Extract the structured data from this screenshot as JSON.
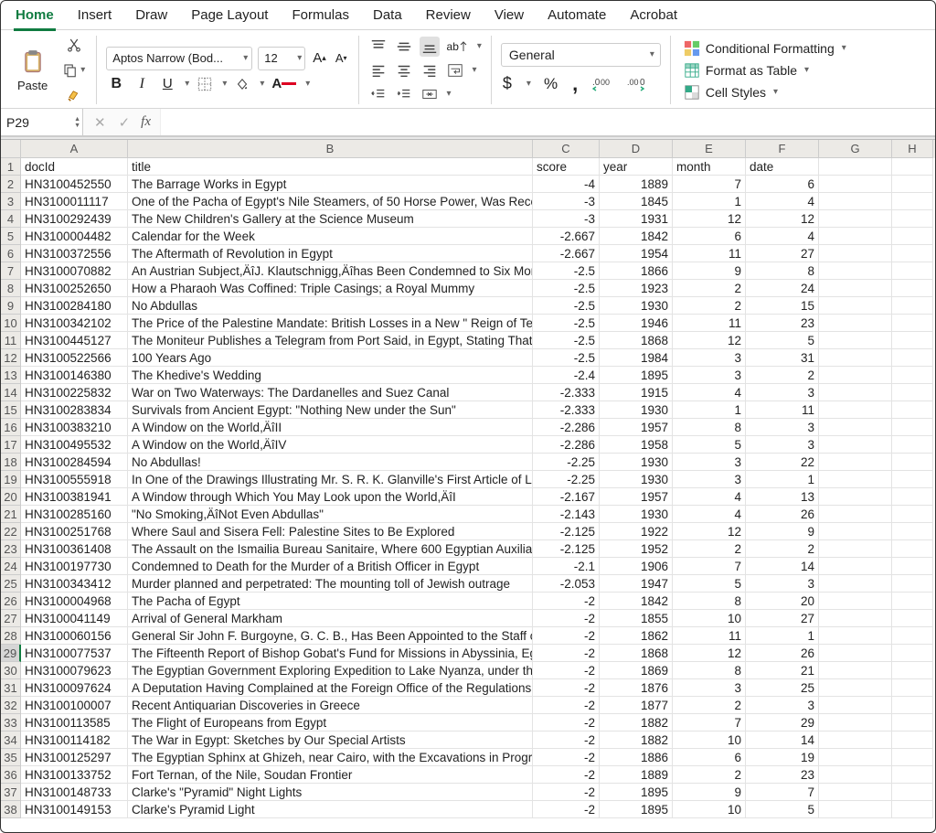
{
  "tabs": [
    "Home",
    "Insert",
    "Draw",
    "Page Layout",
    "Formulas",
    "Data",
    "Review",
    "View",
    "Automate",
    "Acrobat"
  ],
  "activeTab": 0,
  "ribbon": {
    "paste_label": "Paste",
    "font_name": "Aptos Narrow (Bod...",
    "font_size": "12",
    "number_format": "General",
    "styles": {
      "cond_fmt": "Conditional Formatting",
      "fmt_table": "Format as Table",
      "cell_styles": "Cell Styles"
    }
  },
  "namebox": "P29",
  "columns": [
    "A",
    "B",
    "C",
    "D",
    "E",
    "F",
    "G",
    "H"
  ],
  "headerRow": [
    "docId",
    "title",
    "score",
    "year",
    "month",
    "date"
  ],
  "rows": [
    {
      "n": 1
    },
    {
      "n": 2,
      "A": "HN3100452550",
      "B": "The Barrage Works in Egypt",
      "C": "-4",
      "D": "1889",
      "E": "7",
      "F": "6"
    },
    {
      "n": 3,
      "A": "HN3100011117",
      "B": "One of the Pacha of Egypt's Nile Steamers, of 50 Horse Power, Was Recently L",
      "C": "-3",
      "D": "1845",
      "E": "1",
      "F": "4"
    },
    {
      "n": 4,
      "A": "HN3100292439",
      "B": "The New Children's Gallery at the Science Museum",
      "C": "-3",
      "D": "1931",
      "E": "12",
      "F": "12"
    },
    {
      "n": 5,
      "A": "HN3100004482",
      "B": "Calendar for the Week",
      "C": "-2.667",
      "D": "1842",
      "E": "6",
      "F": "4"
    },
    {
      "n": 6,
      "A": "HN3100372556",
      "B": "The Aftermath of Revolution in Egypt",
      "C": "-2.667",
      "D": "1954",
      "E": "11",
      "F": "27"
    },
    {
      "n": 7,
      "A": "HN3100070882",
      "B": "An Austrian Subject,ÄîJ. Klautschnigg,Äîhas Been Condemned to Six Months'",
      "C": "-2.5",
      "D": "1866",
      "E": "9",
      "F": "8"
    },
    {
      "n": 8,
      "A": "HN3100252650",
      "B": "How a Pharaoh Was Coffined: Triple Casings; a Royal Mummy",
      "C": "-2.5",
      "D": "1923",
      "E": "2",
      "F": "24"
    },
    {
      "n": 9,
      "A": "HN3100284180",
      "B": "No Abdullas",
      "C": "-2.5",
      "D": "1930",
      "E": "2",
      "F": "15"
    },
    {
      "n": 10,
      "A": "HN3100342102",
      "B": "The Price of the Palestine Mandate: British Losses in a New \" Reign of Terror. \"",
      "C": "-2.5",
      "D": "1946",
      "E": "11",
      "F": "23"
    },
    {
      "n": 11,
      "A": "HN3100445127",
      "B": "The Moniteur Publishes a Telegram from Port Said, in Egypt, Stating That the F",
      "C": "-2.5",
      "D": "1868",
      "E": "12",
      "F": "5"
    },
    {
      "n": 12,
      "A": "HN3100522566",
      "B": "100 Years Ago",
      "C": "-2.5",
      "D": "1984",
      "E": "3",
      "F": "31"
    },
    {
      "n": 13,
      "A": "HN3100146380",
      "B": "The Khedive's Wedding",
      "C": "-2.4",
      "D": "1895",
      "E": "3",
      "F": "2"
    },
    {
      "n": 14,
      "A": "HN3100225832",
      "B": "War on Two Waterways: The Dardanelles and Suez Canal",
      "C": "-2.333",
      "D": "1915",
      "E": "4",
      "F": "3"
    },
    {
      "n": 15,
      "A": "HN3100283834",
      "B": "Survivals from Ancient Egypt: \"Nothing New under the Sun\"",
      "C": "-2.333",
      "D": "1930",
      "E": "1",
      "F": "11"
    },
    {
      "n": 16,
      "A": "HN3100383210",
      "B": "A Window on the World,ÄîII",
      "C": "-2.286",
      "D": "1957",
      "E": "8",
      "F": "3"
    },
    {
      "n": 17,
      "A": "HN3100495532",
      "B": "A Window on the World,ÄîIV",
      "C": "-2.286",
      "D": "1958",
      "E": "5",
      "F": "3"
    },
    {
      "n": 18,
      "A": "HN3100284594",
      "B": "No Abdullas!",
      "C": "-2.25",
      "D": "1930",
      "E": "3",
      "F": "22"
    },
    {
      "n": 19,
      "A": "HN3100555918",
      "B": "In One of the Drawings Illustrating Mr. S. R. K. Glanville's First Article of Life ai",
      "C": "-2.25",
      "D": "1930",
      "E": "3",
      "F": "1"
    },
    {
      "n": 20,
      "A": "HN3100381941",
      "B": "A Window through Which You May Look upon the World,ÄîI",
      "C": "-2.167",
      "D": "1957",
      "E": "4",
      "F": "13"
    },
    {
      "n": 21,
      "A": "HN3100285160",
      "B": "\"No Smoking,ÄîNot Even Abdullas\"",
      "C": "-2.143",
      "D": "1930",
      "E": "4",
      "F": "26"
    },
    {
      "n": 22,
      "A": "HN3100251768",
      "B": "Where Saul and Sisera Fell: Palestine Sites to Be Explored",
      "C": "-2.125",
      "D": "1922",
      "E": "12",
      "F": "9"
    },
    {
      "n": 23,
      "A": "HN3100361408",
      "B": "The Assault on the Ismailia Bureau Sanitaire, Where 600 Egyptian Auxiliary Po",
      "C": "-2.125",
      "D": "1952",
      "E": "2",
      "F": "2"
    },
    {
      "n": 24,
      "A": "HN3100197730",
      "B": "Condemned to Death for the Murder of a British Officer in Egypt",
      "C": "-2.1",
      "D": "1906",
      "E": "7",
      "F": "14"
    },
    {
      "n": 25,
      "A": "HN3100343412",
      "B": "Murder planned and perpetrated: The mounting toll of Jewish outrage",
      "C": "-2.053",
      "D": "1947",
      "E": "5",
      "F": "3"
    },
    {
      "n": 26,
      "A": "HN3100004968",
      "B": "The Pacha of Egypt",
      "C": "-2",
      "D": "1842",
      "E": "8",
      "F": "20"
    },
    {
      "n": 27,
      "A": "HN3100041149",
      "B": "Arrival of General Markham",
      "C": "-2",
      "D": "1855",
      "E": "10",
      "F": "27"
    },
    {
      "n": 28,
      "A": "HN3100060156",
      "B": "General Sir John F. Burgoyne, G. C. B., Has Been Appointed to the Staff of the",
      "C": "-2",
      "D": "1862",
      "E": "11",
      "F": "1"
    },
    {
      "n": 29,
      "A": "HN3100077537",
      "B": "The Fifteenth Report of Bishop Gobat's Fund for Missions in Abyssinia, Egypt, :",
      "C": "-2",
      "D": "1868",
      "E": "12",
      "F": "26"
    },
    {
      "n": 30,
      "A": "HN3100079623",
      "B": "The Egyptian Government Exploring Expedition to Lake Nyanza, under the Dir",
      "C": "-2",
      "D": "1869",
      "E": "8",
      "F": "21"
    },
    {
      "n": 31,
      "A": "HN3100097624",
      "B": "A Deputation Having Complained at the Foreign Office of the Regulations Enf",
      "C": "-2",
      "D": "1876",
      "E": "3",
      "F": "25"
    },
    {
      "n": 32,
      "A": "HN3100100007",
      "B": "Recent Antiquarian Discoveries in Greece",
      "C": "-2",
      "D": "1877",
      "E": "2",
      "F": "3"
    },
    {
      "n": 33,
      "A": "HN3100113585",
      "B": "The Flight of Europeans from Egypt",
      "C": "-2",
      "D": "1882",
      "E": "7",
      "F": "29"
    },
    {
      "n": 34,
      "A": "HN3100114182",
      "B": "The War in Egypt: Sketches by Our Special Artists",
      "C": "-2",
      "D": "1882",
      "E": "10",
      "F": "14"
    },
    {
      "n": 35,
      "A": "HN3100125297",
      "B": "The Egyptian Sphinx at Ghizeh, near Cairo, with the Excavations in Progress",
      "C": "-2",
      "D": "1886",
      "E": "6",
      "F": "19"
    },
    {
      "n": 36,
      "A": "HN3100133752",
      "B": "Fort Ternan, of the Nile, Soudan Frontier",
      "C": "-2",
      "D": "1889",
      "E": "2",
      "F": "23"
    },
    {
      "n": 37,
      "A": "HN3100148733",
      "B": "Clarke's \"Pyramid\" Night Lights",
      "C": "-2",
      "D": "1895",
      "E": "9",
      "F": "7"
    },
    {
      "n": 38,
      "A": "HN3100149153",
      "B": "Clarke's Pyramid Light",
      "C": "-2",
      "D": "1895",
      "E": "10",
      "F": "5"
    }
  ]
}
